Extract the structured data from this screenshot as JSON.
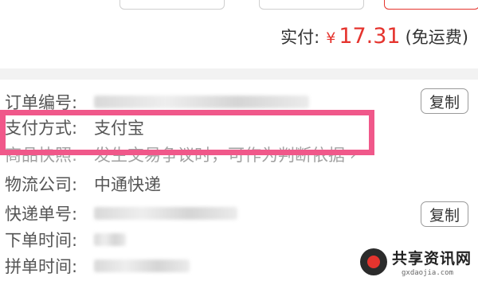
{
  "payment": {
    "label": "实付:",
    "currency": "¥",
    "amount": "17.31",
    "shipping_note": "(免运费)"
  },
  "order": {
    "rows": [
      {
        "label": "订单编号:",
        "value": ""
      },
      {
        "label": "支付方式:",
        "value": "支付宝"
      },
      {
        "label": "商品快照:",
        "value": "发生交易争议时，可作为判断依据"
      },
      {
        "label": "物流公司:",
        "value": "中通快递"
      },
      {
        "label": "快递单号:",
        "value": ""
      },
      {
        "label": "下单时间:",
        "value": ""
      },
      {
        "label": "拼单时间:",
        "value": ""
      }
    ],
    "copy_label": "复制"
  },
  "watermark": {
    "title": "共享资讯网",
    "subtitle": "gxdaojia.com"
  },
  "colors": {
    "price_red": "#e5342e",
    "highlight_pink": "#f0588a"
  }
}
